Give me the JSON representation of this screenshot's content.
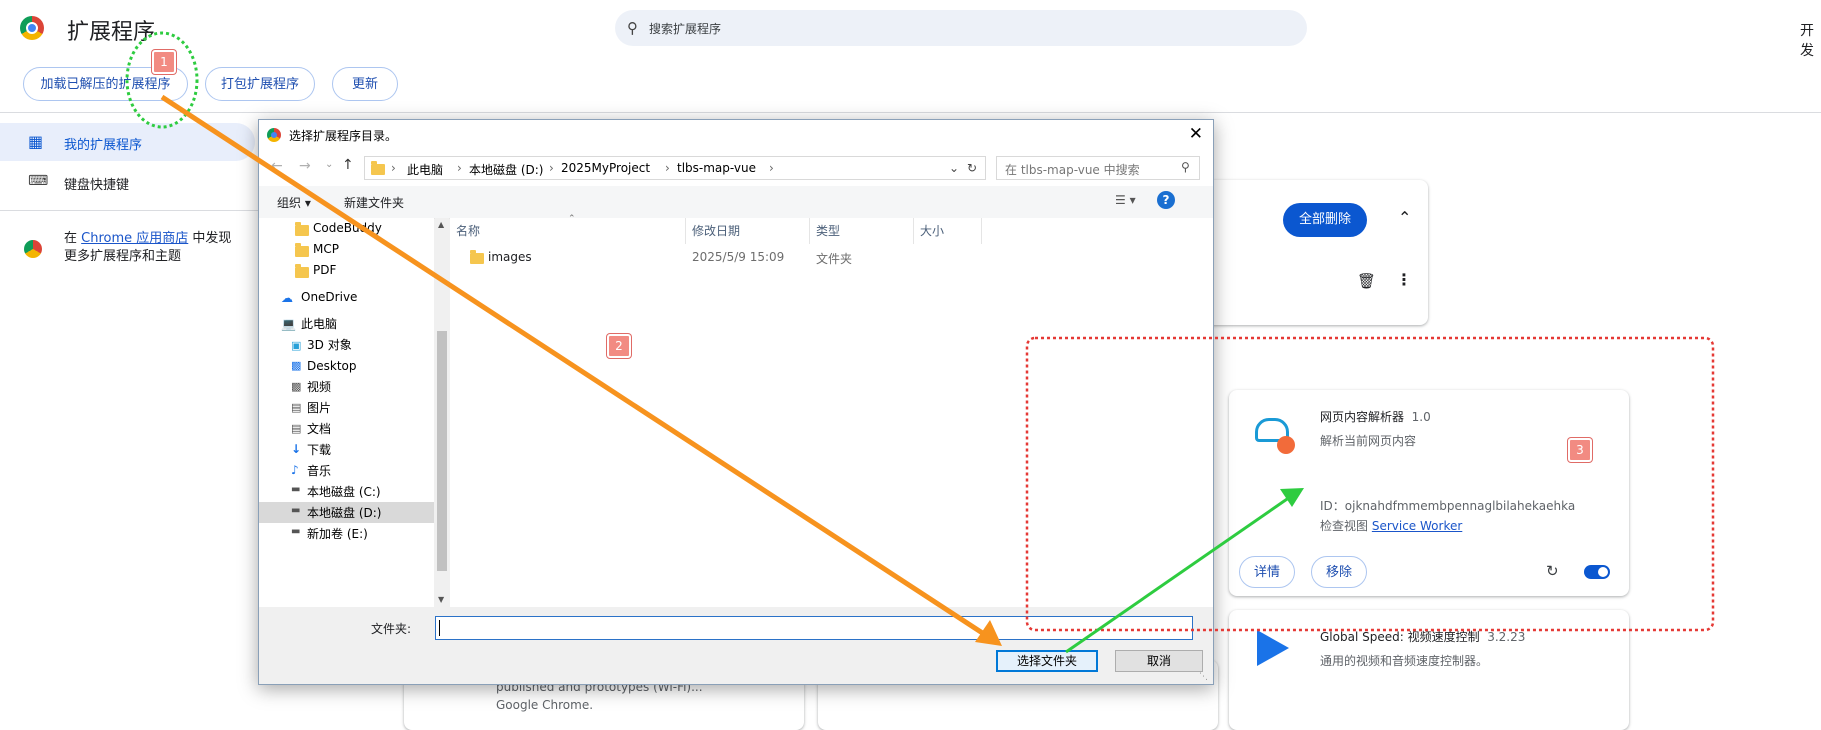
{
  "header": {
    "title": "扩展程序",
    "search_placeholder": "搜索扩展程序",
    "dev_mode_label": "开发"
  },
  "toolbar": {
    "load_unpacked": "加载已解压的扩展程序",
    "pack": "打包扩展程序",
    "update": "更新"
  },
  "sidebar": {
    "items": [
      {
        "label": "我的扩展程序",
        "selected": true
      },
      {
        "label": "键盘快捷键",
        "selected": false
      }
    ],
    "store_prefix": "在",
    "store_link": "Chrome 应用商店",
    "store_suffix": "中发现",
    "store_line2": "更多扩展程序和主题"
  },
  "top_card": {
    "remove_all": "全部删除"
  },
  "extensions": [
    {
      "name": "网页内容解析器",
      "version": "1.0",
      "description": "解析当前网页内容",
      "id_label": "ID：",
      "id": "ojknahdfmmembpennaglbilahekaehka",
      "inspect_label": "检查视图",
      "inspect_link": "Service Worker",
      "details": "详情",
      "remove": "移除",
      "enabled": true
    },
    {
      "name": "Global Speed: 视频速度控制",
      "version": "3.2.23",
      "description": "通用的视频和音频速度控制器。"
    }
  ],
  "background_card_text": [
    "published and prototypes (Wi-Fi)...",
    "Google Chrome."
  ],
  "dialog": {
    "title": "选择扩展程序目录。",
    "breadcrumbs": [
      "此电脑",
      "本地磁盘 (D:)",
      "2025MyProject",
      "tlbs-map-vue"
    ],
    "search_placeholder": "在 tlbs-map-vue 中搜索",
    "organize": "组织",
    "new_folder": "新建文件夹",
    "tree": [
      {
        "label": "CodeBuddy",
        "icon": "folder-icon"
      },
      {
        "label": "MCP",
        "icon": "folder-icon"
      },
      {
        "label": "PDF",
        "icon": "folder-icon"
      },
      {
        "label": "OneDrive",
        "icon": "cloud-icon"
      },
      {
        "label": "此电脑",
        "icon": "computer-icon"
      },
      {
        "label": "3D 对象",
        "icon": "cube-icon"
      },
      {
        "label": "Desktop",
        "icon": "desktop-icon"
      },
      {
        "label": "视频",
        "icon": "video-icon"
      },
      {
        "label": "图片",
        "icon": "picture-icon"
      },
      {
        "label": "文档",
        "icon": "document-icon"
      },
      {
        "label": "下载",
        "icon": "download-icon"
      },
      {
        "label": "音乐",
        "icon": "music-icon"
      },
      {
        "label": "本地磁盘 (C:)",
        "icon": "drive-icon"
      },
      {
        "label": "本地磁盘 (D:)",
        "icon": "drive-icon",
        "selected": true
      },
      {
        "label": "新加卷 (E:)",
        "icon": "drive-icon"
      }
    ],
    "columns": [
      "名称",
      "修改日期",
      "类型",
      "大小"
    ],
    "files": [
      {
        "name": "images",
        "modified": "2025/5/9 15:09",
        "type": "文件夹",
        "size": ""
      }
    ],
    "folder_label": "文件夹:",
    "folder_value": "",
    "select_button": "选择文件夹",
    "cancel_button": "取消"
  },
  "annotations": {
    "badge1": "1",
    "badge2": "2",
    "badge3": "3",
    "green_color": "#2ecc40",
    "red_color": "#e53935",
    "orange_color": "#f7931e"
  }
}
